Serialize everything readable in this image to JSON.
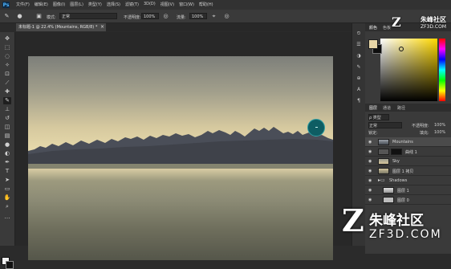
{
  "app": {
    "logo": "Ps"
  },
  "menu": [
    "文件(F)",
    "编辑(E)",
    "图像(I)",
    "图层(L)",
    "类型(Y)",
    "选择(S)",
    "滤镜(T)",
    "3D(D)",
    "视图(V)",
    "窗口(W)",
    "帮助(H)"
  ],
  "options": {
    "mode_label": "模式:",
    "mode_value": "正常",
    "opacity_label": "不透明度:",
    "opacity_value": "100%",
    "flow_label": "流量:",
    "flow_value": "100%"
  },
  "document_tab": {
    "title": "未标题-1 @ 22.4% (Mountains, RGB/8) *",
    "close": "×"
  },
  "right_panels": {
    "color_tabs": [
      "颜色",
      "色板"
    ],
    "layers_tabs": [
      "图层",
      "通道",
      "路径"
    ],
    "filter_label": "ρ 类型",
    "blend_mode": "正常",
    "opacity_label": "不透明度:",
    "opacity_value": "100%",
    "lock_label": "锁定:",
    "fill_label": "填充:",
    "fill_value": "100%"
  },
  "layers": [
    {
      "name": "Mountains",
      "selected": true
    },
    {
      "name": "曲线 1",
      "selected": false
    },
    {
      "name": "Sky",
      "selected": false
    },
    {
      "name": "图层 1 拷贝",
      "selected": false
    },
    {
      "name": "Shadows",
      "selected": false,
      "folder": true
    },
    {
      "name": "图层 1",
      "selected": false
    },
    {
      "name": "图层 0",
      "selected": false
    }
  ],
  "watermark": {
    "top_letter": "Z",
    "top_cn": "朱峰社区",
    "top_en": "ZF3D.COM",
    "letter": "Z",
    "cn": "朱峰社区",
    "en": "ZF3D.COM"
  },
  "colors": {
    "foreground": "#e7d6a6",
    "background": "#0e0e0e",
    "brush": "#0e5d63"
  }
}
